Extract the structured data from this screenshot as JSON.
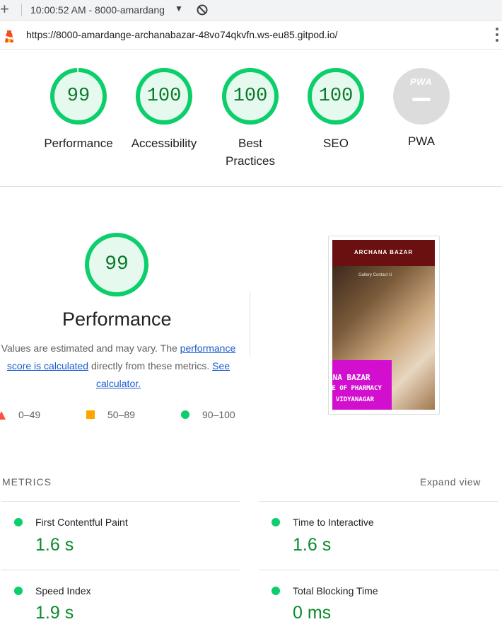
{
  "toolbar": {
    "session": "10:00:52 AM - 8000-amardang",
    "url": "https://8000-amardange-archanabazar-48vo74qkvfn.ws-eu85.gitpod.io/"
  },
  "scores": [
    {
      "value": "99",
      "label_line1": "Performance",
      "label_line2": ""
    },
    {
      "value": "100",
      "label_line1": "Accessibility",
      "label_line2": ""
    },
    {
      "value": "100",
      "label_line1": "Best",
      "label_line2": "Practices"
    },
    {
      "value": "100",
      "label_line1": "SEO",
      "label_line2": ""
    }
  ],
  "pwa": {
    "badge": "PWA",
    "label": "PWA"
  },
  "performance": {
    "score": "99",
    "score_fraction": 0.99,
    "title": "Performance",
    "desc_prefix": "Values are estimated and may vary. The ",
    "desc_link": "performance score is calculated",
    "desc_middle": " directly from these metrics. ",
    "desc_link2": "See calculator."
  },
  "legend": {
    "fail": "0–49",
    "average": "50–89",
    "pass": "90–100"
  },
  "thumbnail": {
    "brand": "ARCHANA BAZAR",
    "nav": "Gallery  Contact U",
    "line1": "ANA BAZAR",
    "line2": "TE OF PHARMACY",
    "line3": "E VIDYANAGAR"
  },
  "metrics": {
    "title": "METRICS",
    "expand": "Expand view",
    "items": [
      {
        "label": "First Contentful Paint",
        "value": "1.6 s"
      },
      {
        "label": "Time to Interactive",
        "value": "1.6 s"
      },
      {
        "label": "Speed Index",
        "value": "1.9 s"
      },
      {
        "label": "Total Blocking Time",
        "value": "0 ms"
      }
    ]
  },
  "colors": {
    "pass": "#0cce6b",
    "average": "#ffa400",
    "fail": "#ff4e42",
    "link": "#1a5ccf"
  }
}
